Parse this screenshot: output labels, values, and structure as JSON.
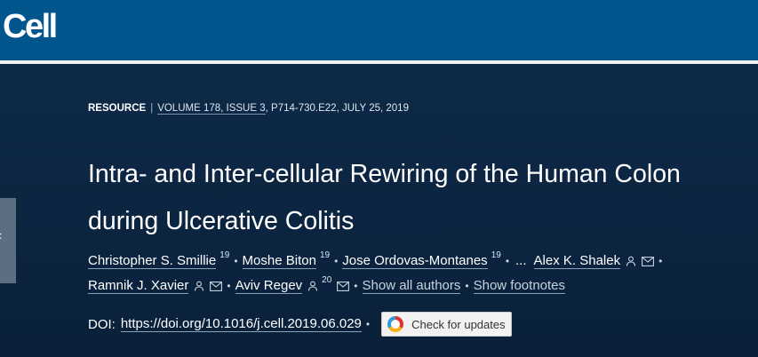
{
  "header": {
    "logo_text": "Cell",
    "brand_color": "#00558c"
  },
  "article": {
    "type": "RESOURCE",
    "volume_issue": "VOLUME 178, ISSUE 3",
    "pages_date": "P714-730.E22, JULY 25, 2019",
    "title_line1": "Intra- and Inter-cellular Rewiring of the Human Colon",
    "title_line2": "during Ulcerative Colitis",
    "authors": [
      {
        "name": "Christopher S. Smillie",
        "sup": "19"
      },
      {
        "name": "Moshe Biton",
        "sup": "19"
      },
      {
        "name": "Jose Ordovas-Montanes",
        "sup": "19"
      },
      {
        "name": "Alex K. Shalek"
      },
      {
        "name": "Ramnik J. Xavier"
      },
      {
        "name": "Aviv Regev",
        "sup": "20"
      }
    ],
    "ellipsis": "...",
    "show_all_authors": "Show all authors",
    "show_footnotes": "Show footnotes",
    "doi_label": "DOI:",
    "doi_link": "https://doi.org/10.1016/j.cell.2019.06.029",
    "check_updates": "Check for updates"
  },
  "icons": {
    "side_tab": "chevron-left-icon",
    "person": "person-icon",
    "email": "envelope-icon",
    "crossmark": "crossmark-icon"
  }
}
